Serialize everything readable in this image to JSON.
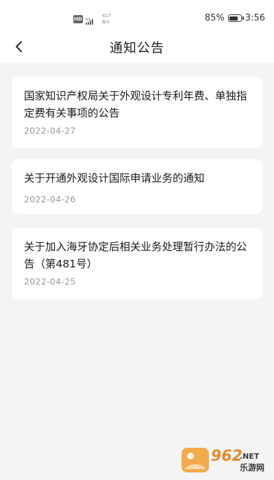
{
  "status_bar": {
    "badge": "HD",
    "signal_label": "5G",
    "net_speed_value": "417",
    "net_speed_unit": "B/s",
    "battery": "85%",
    "battery_level": 0.85,
    "time": "3:56"
  },
  "nav": {
    "title": "通知公告",
    "back_icon": "chevron-left-icon"
  },
  "notices": [
    {
      "title": "国家知识产权局关于外观设计专利年费、单独指定费有关事项的公告",
      "date": "2022-04-27"
    },
    {
      "title": "关于开通外观设计国际申请业务的通知",
      "date": "2022-04-26"
    },
    {
      "title": "关于加入海牙协定后相关业务处理暂行办法的公告（第481号）",
      "date": "2022-04-25"
    }
  ],
  "watermark": {
    "brand_number": "962",
    "brand_suffix": ".NET",
    "brand_name": "乐游网"
  }
}
